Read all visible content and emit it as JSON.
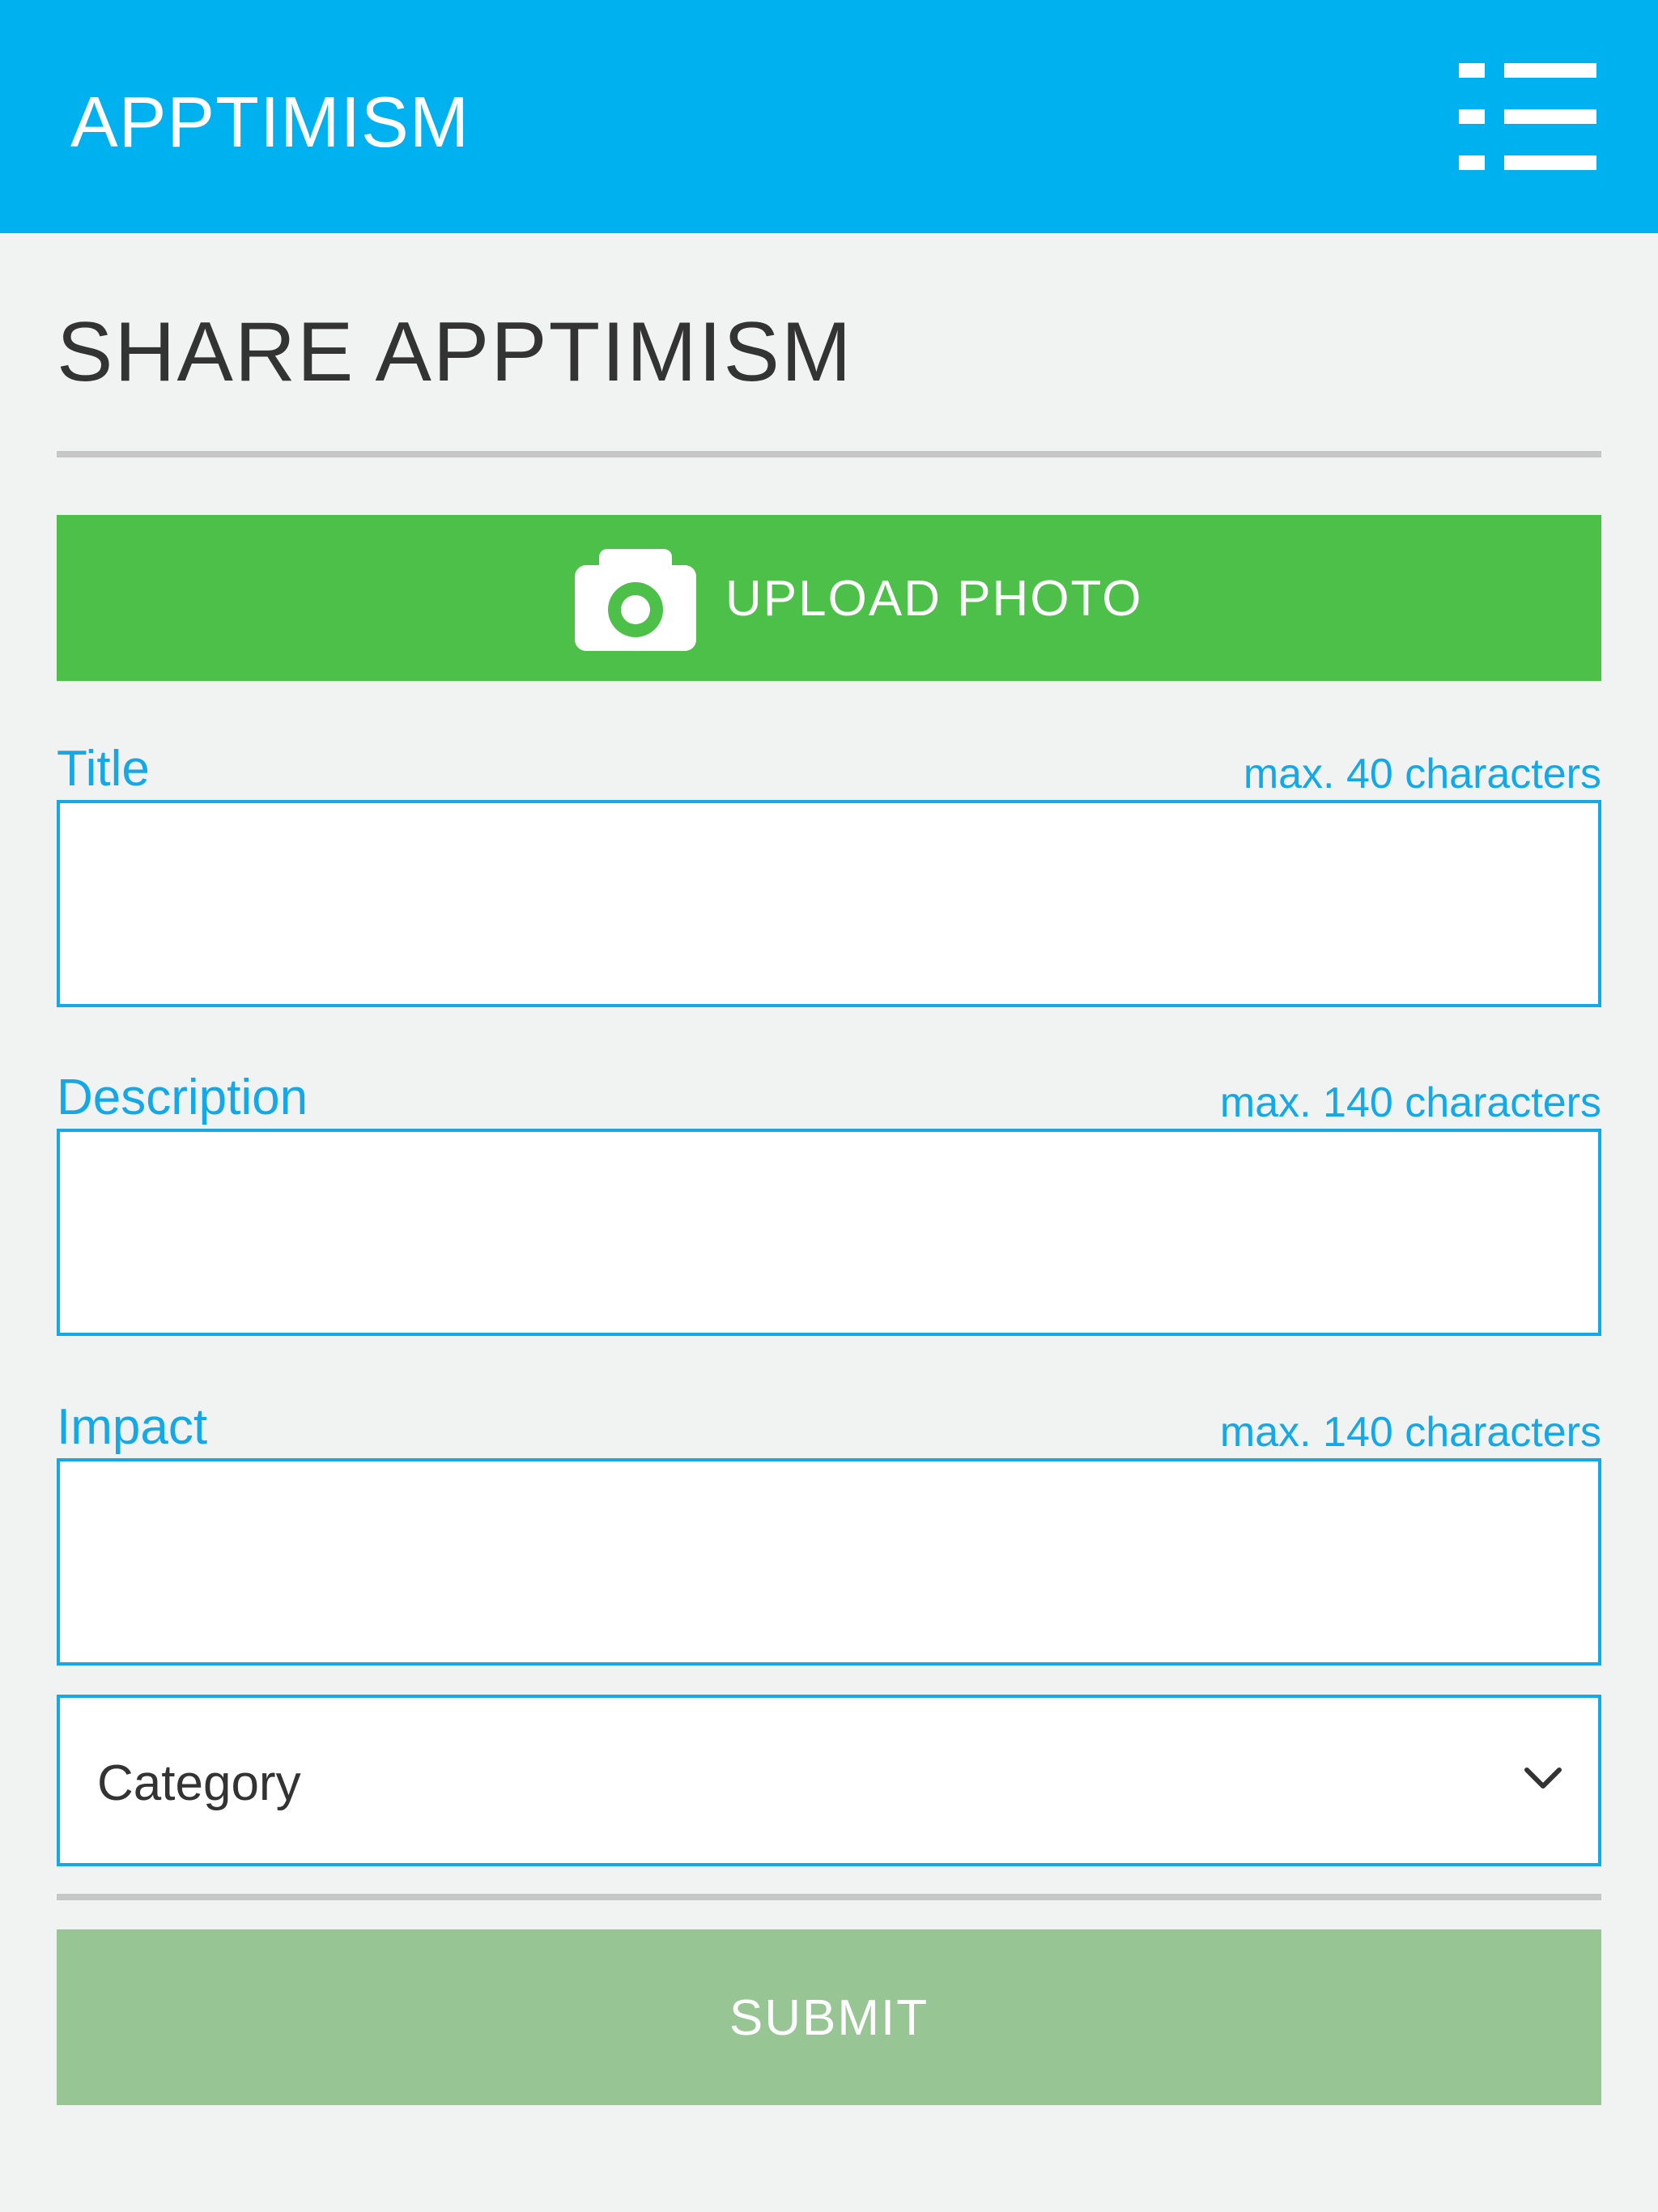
{
  "colors": {
    "header": "#00b1f0",
    "accent": "#15a8e6",
    "upload_button": "#4dc04a",
    "submit_button": "#97c594",
    "background": "#f1f3f2"
  },
  "header": {
    "brand": "APPTIMISM",
    "menu_icon": "menu-list-icon"
  },
  "page": {
    "title": "SHARE APPTIMISM"
  },
  "upload": {
    "icon": "camera-icon",
    "label": "UPLOAD PHOTO"
  },
  "form": {
    "title": {
      "label": "Title",
      "hint": "max. 40 characters",
      "value": ""
    },
    "description": {
      "label": "Description",
      "hint": "max. 140 characters",
      "value": ""
    },
    "impact": {
      "label": "Impact",
      "hint": "max. 140 characters",
      "value": ""
    },
    "category": {
      "selected": "Category",
      "icon": "chevron-down-icon"
    },
    "submit_label": "SUBMIT"
  }
}
